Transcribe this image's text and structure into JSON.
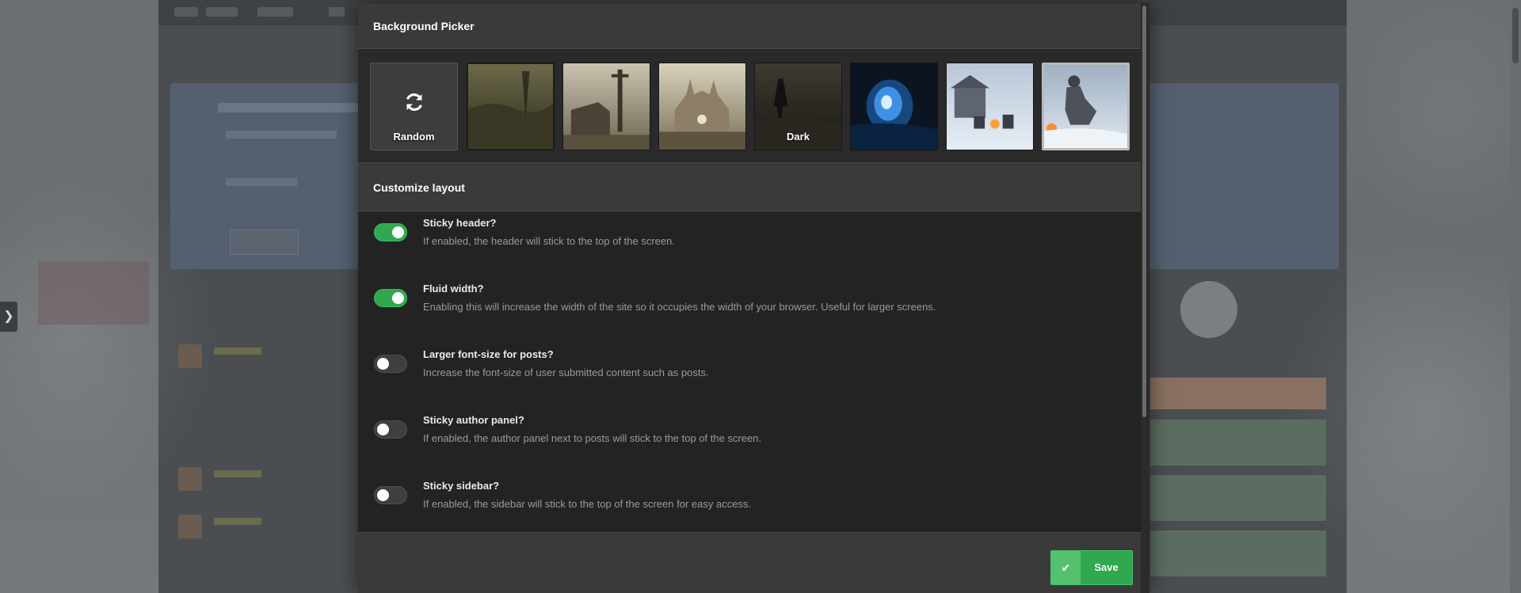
{
  "picker": {
    "heading": "Background Picker",
    "random_label": "Random",
    "dark_label": "Dark"
  },
  "layout": {
    "heading": "Customize layout",
    "options": [
      {
        "title": "Sticky header?",
        "desc": "If enabled, the header will stick to the top of the screen.",
        "enabled": true
      },
      {
        "title": "Fluid width?",
        "desc": "Enabling this will increase the width of the site so it occupies the width of your browser. Useful for larger screens.",
        "enabled": true
      },
      {
        "title": "Larger font-size for posts?",
        "desc": "Increase the font-size of user submitted content such as posts.",
        "enabled": false
      },
      {
        "title": "Sticky author panel?",
        "desc": "If enabled, the author panel next to posts will stick to the top of the screen.",
        "enabled": false
      },
      {
        "title": "Sticky sidebar?",
        "desc": "If enabled, the sidebar will stick to the top of the screen for easy access.",
        "enabled": false
      }
    ]
  },
  "footer": {
    "save_label": "Save"
  },
  "side_tab": {
    "icon": "chevron-right-icon"
  },
  "colors": {
    "toggle_on": "#2fa84f",
    "save_button": "#2fa84f",
    "modal_bg": "#232323",
    "header_bg": "#3a3a3a"
  }
}
